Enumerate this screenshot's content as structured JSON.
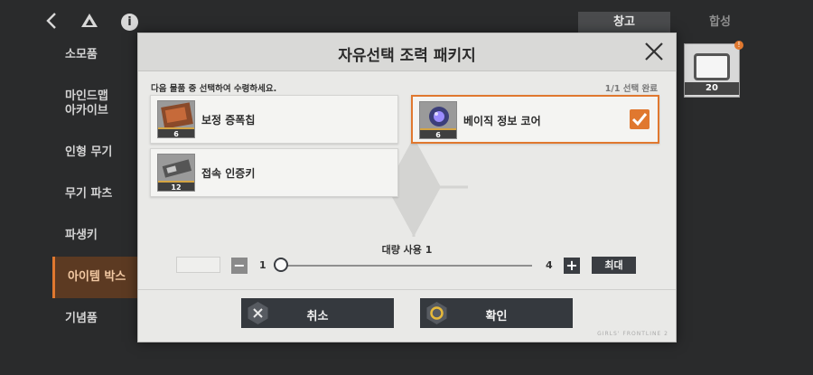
{
  "header": {
    "back_icon": "chevron-left-icon",
    "logo_icon": "triangle-logo-icon",
    "info_icon": "info-icon",
    "info_glyph": "i",
    "tabs": [
      {
        "label": "창고",
        "active": true
      },
      {
        "label": "합성",
        "active": false
      }
    ]
  },
  "sidebar": {
    "items": [
      {
        "label": "소모품"
      },
      {
        "label": "마인드맵\n아카이브"
      },
      {
        "label": "인형 무기"
      },
      {
        "label": "무기 파츠"
      },
      {
        "label": "파생키"
      },
      {
        "label": "아이템 박스",
        "active": true
      },
      {
        "label": "기념품"
      }
    ]
  },
  "inventory": {
    "tile_count": "20",
    "badge": "!"
  },
  "modal": {
    "title": "자유선택 조력 패키지",
    "instruction": "다음 물품 중 선택하여 수령하세요.",
    "status": "1/1 선택 완료",
    "options": [
      {
        "label": "보정 증폭칩",
        "qty": "6",
        "selected": false,
        "icon": "chip-icon"
      },
      {
        "label": "베이직 정보 코어",
        "qty": "6",
        "selected": true,
        "icon": "crystal-core-icon"
      },
      {
        "label": "접속 인증키",
        "qty": "12",
        "selected": false,
        "icon": "keycard-icon"
      }
    ],
    "quantity": {
      "title": "대량 사용 1",
      "min": "1",
      "max": "4",
      "max_button": "최대",
      "current_fraction": 0
    },
    "buttons": {
      "cancel": "취소",
      "confirm": "확인"
    },
    "brand": "GIRLS' FRONTLINE 2"
  },
  "colors": {
    "accent": "#e0782f",
    "dark_button": "#35393e",
    "modal_bg": "#e9e9e7"
  }
}
